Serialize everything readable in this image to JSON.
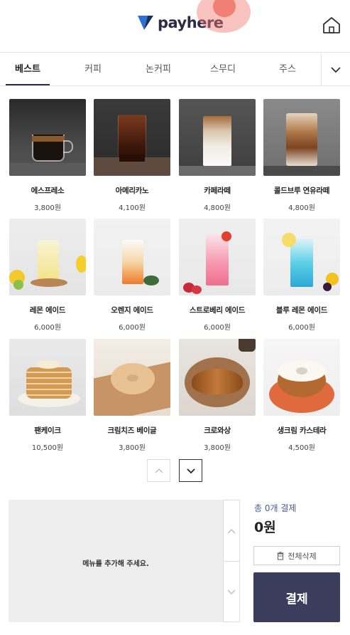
{
  "header": {
    "brand": "payhere",
    "icons": {
      "logo": "payhere-logo-mark",
      "home": "home-icon"
    }
  },
  "tabs": [
    {
      "label": "베스트",
      "active": true
    },
    {
      "label": "커피",
      "active": false
    },
    {
      "label": "논커피",
      "active": false
    },
    {
      "label": "스무디",
      "active": false
    },
    {
      "label": "주스",
      "active": false
    }
  ],
  "tab_more_icon": "chevron-down-icon",
  "products": [
    {
      "name": "에스프레소",
      "price": "3,800원"
    },
    {
      "name": "아메리카노",
      "price": "4,100원"
    },
    {
      "name": "카페라떼",
      "price": "4,800원"
    },
    {
      "name": "콜드브루 연유라떼",
      "price": "4,800원"
    },
    {
      "name": "레몬 에이드",
      "price": "6,000원"
    },
    {
      "name": "오렌지 에이드",
      "price": "6,000원"
    },
    {
      "name": "스트로베리 에이드",
      "price": "6,000원"
    },
    {
      "name": "블루 레몬 에이드",
      "price": "6,000원"
    },
    {
      "name": "팬케이크",
      "price": "10,500원"
    },
    {
      "name": "크림치즈 베이글",
      "price": "3,800원"
    },
    {
      "name": "크로와상",
      "price": "3,800원"
    },
    {
      "name": "생크림 카스테라",
      "price": "4,500원"
    }
  ],
  "pager": {
    "up_icon": "chevron-up-icon",
    "down_icon": "chevron-down-icon"
  },
  "cart": {
    "empty_message": "메뉴를 추가해 주세요.",
    "summary_label": "총 0개 결제",
    "total": "0원",
    "clear_label": "전체삭제",
    "clear_icon": "trash-icon",
    "pay_label": "결제"
  },
  "colors": {
    "brand_navy": "#2a2d45",
    "pay_button": "#3a3d5c",
    "summary_accent": "#4b5a9a",
    "logo_blue": "#2f6fd6"
  }
}
